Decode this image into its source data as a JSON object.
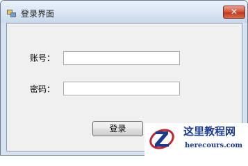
{
  "window": {
    "title": "登录界面",
    "close_glyph": "✕"
  },
  "form": {
    "account_label": "账号：",
    "account_value": "",
    "password_label": "密码：",
    "password_value": "",
    "login_button_label": "登录"
  },
  "watermark": {
    "title": "这里教程网",
    "url": "herecours.com"
  },
  "colors": {
    "titlebar": "#dbe7f4",
    "client_bg": "#f0f0f0",
    "close_button": "#c23a1e",
    "watermark_text": "#1b3a8c",
    "watermark_logo": "#c0282d"
  },
  "icons": {
    "app": "app-window-icon",
    "close": "close-icon",
    "watermark_logo": "site-logo-icon"
  }
}
